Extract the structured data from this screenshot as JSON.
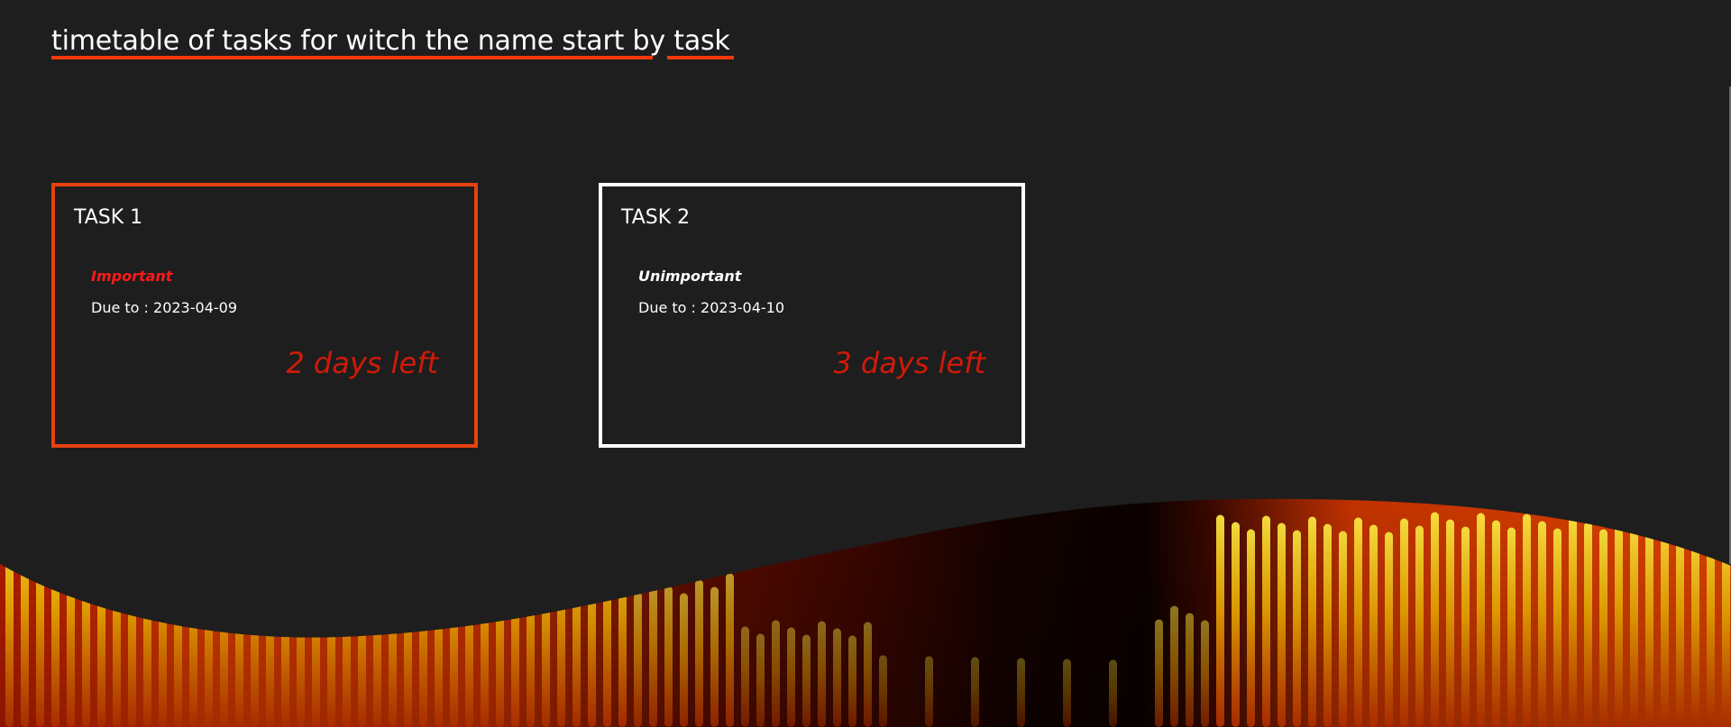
{
  "page": {
    "title": "timetable of tasks for witch the name start by task"
  },
  "colors": {
    "background": "#1e1e1e",
    "accent": "#e6410f",
    "important": "#ff1a1a",
    "days_left": "#d11a08"
  },
  "tasks": [
    {
      "name": "TASK 1",
      "priority": "Important",
      "priority_color": "#ff1a1a",
      "due_label": "Due to : ",
      "due_date": "2023-04-09",
      "days_left_text": "2 days left"
    },
    {
      "name": "TASK 2",
      "priority": "Unimportant",
      "priority_color": "#ffffff",
      "due_label": "Due to : ",
      "due_date": "2023-04-10",
      "days_left_text": "3 days left"
    }
  ]
}
